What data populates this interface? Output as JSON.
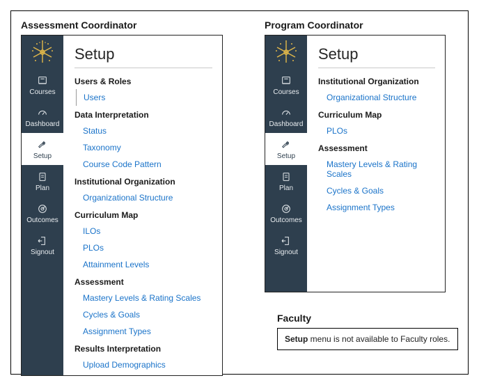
{
  "roles": {
    "assessment": "Assessment Coordinator",
    "program": "Program Coordinator",
    "faculty": "Faculty"
  },
  "page_title": "Setup",
  "nav": {
    "courses": "Courses",
    "dashboard": "Dashboard",
    "setup": "Setup",
    "plan": "Plan",
    "outcomes": "Outcomes",
    "signout": "Signout"
  },
  "assessment_sections": [
    {
      "title": "Users & Roles",
      "first": true,
      "items": [
        "Users"
      ]
    },
    {
      "title": "Data Interpretation",
      "items": [
        "Status",
        "Taxonomy",
        "Course Code Pattern"
      ]
    },
    {
      "title": "Institutional Organization",
      "items": [
        "Organizational Structure"
      ]
    },
    {
      "title": "Curriculum Map",
      "items": [
        "ILOs",
        "PLOs",
        "Attainment Levels"
      ]
    },
    {
      "title": "Assessment",
      "items": [
        "Mastery Levels & Rating Scales",
        "Cycles & Goals",
        "Assignment Types"
      ]
    },
    {
      "title": "Results Interpretation",
      "items": [
        "Upload Demographics"
      ]
    }
  ],
  "program_sections": [
    {
      "title": "Institutional Organization",
      "items": [
        "Organizational Structure"
      ]
    },
    {
      "title": "Curriculum Map",
      "items": [
        "PLOs"
      ]
    },
    {
      "title": "Assessment",
      "items": [
        "Mastery Levels & Rating Scales",
        "Cycles & Goals",
        "Assignment Types"
      ]
    }
  ],
  "faculty_note_prefix": "Setup",
  "faculty_note_rest": " menu is not available to Faculty roles."
}
